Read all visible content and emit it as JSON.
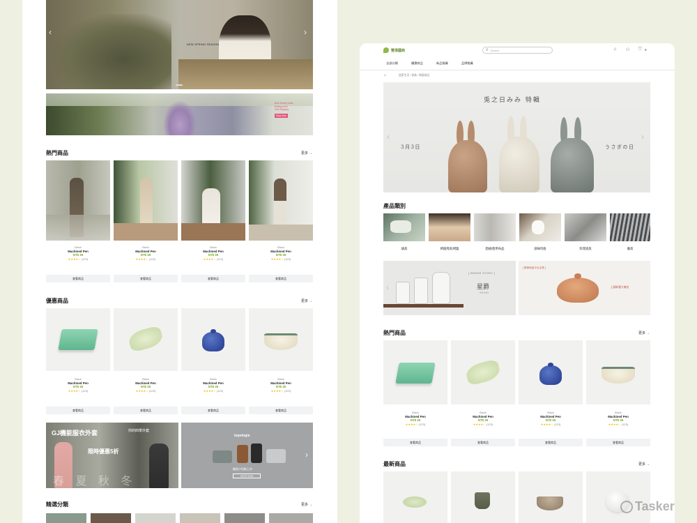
{
  "colors": {
    "price": "#6fa61e",
    "star": "#f2b600",
    "bg": "#eef0e2"
  },
  "left": {
    "hero": {
      "label": "NEW SPRING SEASON"
    },
    "banner2": {
      "lines": [
        "Best Weekly Deals",
        "Ending soon!",
        "Free Shipping",
        "Shop Now"
      ]
    },
    "hot": {
      "title": "熱門商品",
      "more": "更多 →"
    },
    "sale": {
      "title": "優惠商品",
      "more": "更多 →"
    },
    "featured": {
      "title": "精選分類",
      "more": "更多 →"
    },
    "promo": {
      "headline": "GJ機能服衣外套",
      "discount": "限時優惠5折",
      "tag": "你的四季外套",
      "bottom": "春 夏 秋 冬"
    },
    "topologie": {
      "brand": "topologie",
      "text": "機身小包新上市",
      "btn": "SHOP NOW"
    }
  },
  "product": {
    "variant": "Black",
    "name": "Machined Pen",
    "price": "NT$ 35",
    "stars": "★★★★☆",
    "rating": "(123)",
    "button": "查看商品"
  },
  "right": {
    "logo_text": "雙清國商",
    "search_placeholder": "Search",
    "cart_count": "0",
    "nav": [
      "全部分類",
      "優惠商品",
      "新品推薦",
      "品牌推薦"
    ],
    "breadcrumb": "居家生活 / 餐具 / 陶瓷商品",
    "hero": {
      "title": "兎之日みみ 特輯",
      "left": "3月3日",
      "right": "うさぎの日"
    },
    "categories": {
      "title": "產品類別",
      "items": [
        "鍋具",
        "烤箱用具/烤盤",
        "圍裙/廚用布品",
        "調味料瓶",
        "料理道具",
        "餐具"
      ]
    },
    "brand": {
      "tag": "[ BRAND STORY ]",
      "name": "星爵",
      "sub": "SHIHO"
    },
    "brand2": {
      "tag": "[ 廚房用品中大主角 ]",
      "text": "土鍋料理大集合"
    },
    "hot": {
      "title": "熱門商品",
      "more": "更多 →"
    },
    "new": {
      "title": "最新商品",
      "more": "更多 →"
    }
  },
  "watermark": "Tasker"
}
